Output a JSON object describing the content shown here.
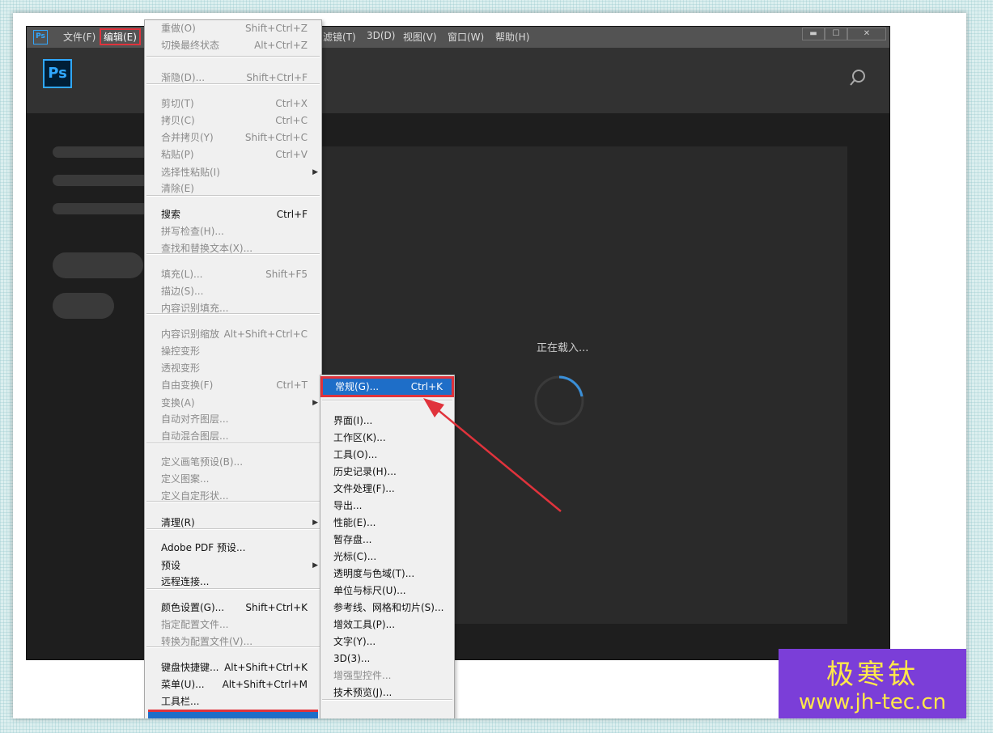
{
  "menubar": {
    "items": [
      "文件(F)",
      "编辑(E)",
      "滤镜(T)",
      "3D(D)",
      "视图(V)",
      "窗口(W)",
      "帮助(H)"
    ],
    "ps_badge": "Ps",
    "window_controls": [
      "▬",
      "☐",
      "✕"
    ]
  },
  "topbar": {
    "logo": "Ps"
  },
  "main": {
    "loading_text": "正在载入..."
  },
  "edit_menu": {
    "items": [
      {
        "label": "重做(O)",
        "shortcut": "Shift+Ctrl+Z"
      },
      {
        "label": "切换最终状态",
        "shortcut": "Alt+Ctrl+Z"
      },
      {
        "label": "渐隐(D)...",
        "shortcut": "Shift+Ctrl+F"
      },
      {
        "label": "剪切(T)",
        "shortcut": "Ctrl+X"
      },
      {
        "label": "拷贝(C)",
        "shortcut": "Ctrl+C"
      },
      {
        "label": "合并拷贝(Y)",
        "shortcut": "Shift+Ctrl+C"
      },
      {
        "label": "粘贴(P)",
        "shortcut": "Ctrl+V"
      },
      {
        "label": "选择性粘贴(I)",
        "shortcut": ""
      },
      {
        "label": "清除(E)",
        "shortcut": ""
      },
      {
        "label": "搜索",
        "shortcut": "Ctrl+F"
      },
      {
        "label": "拼写检查(H)...",
        "shortcut": ""
      },
      {
        "label": "查找和替换文本(X)...",
        "shortcut": ""
      },
      {
        "label": "填充(L)...",
        "shortcut": "Shift+F5"
      },
      {
        "label": "描边(S)...",
        "shortcut": ""
      },
      {
        "label": "内容识别填充...",
        "shortcut": ""
      },
      {
        "label": "内容识别缩放",
        "shortcut": "Alt+Shift+Ctrl+C"
      },
      {
        "label": "操控变形",
        "shortcut": ""
      },
      {
        "label": "透视变形",
        "shortcut": ""
      },
      {
        "label": "自由变换(F)",
        "shortcut": "Ctrl+T"
      },
      {
        "label": "变换(A)",
        "shortcut": ""
      },
      {
        "label": "自动对齐图层...",
        "shortcut": ""
      },
      {
        "label": "自动混合图层...",
        "shortcut": ""
      },
      {
        "label": "定义画笔预设(B)...",
        "shortcut": ""
      },
      {
        "label": "定义图案...",
        "shortcut": ""
      },
      {
        "label": "定义自定形状...",
        "shortcut": ""
      },
      {
        "label": "清理(R)",
        "shortcut": ""
      },
      {
        "label": "Adobe PDF 预设...",
        "shortcut": ""
      },
      {
        "label": "预设",
        "shortcut": ""
      },
      {
        "label": "远程连接...",
        "shortcut": ""
      },
      {
        "label": "颜色设置(G)...",
        "shortcut": "Shift+Ctrl+K"
      },
      {
        "label": "指定配置文件...",
        "shortcut": ""
      },
      {
        "label": "转换为配置文件(V)...",
        "shortcut": ""
      },
      {
        "label": "键盘快捷键...",
        "shortcut": "Alt+Shift+Ctrl+K"
      },
      {
        "label": "菜单(U)...",
        "shortcut": "Alt+Shift+Ctrl+M"
      },
      {
        "label": "工具栏...",
        "shortcut": ""
      }
    ]
  },
  "prefs_submenu": {
    "items": [
      {
        "label": "常规(G)...",
        "shortcut": "Ctrl+K"
      },
      {
        "label": "界面(I)..."
      },
      {
        "label": "工作区(K)..."
      },
      {
        "label": "工具(O)..."
      },
      {
        "label": "历史记录(H)..."
      },
      {
        "label": "文件处理(F)..."
      },
      {
        "label": "导出..."
      },
      {
        "label": "性能(E)..."
      },
      {
        "label": "暂存盘..."
      },
      {
        "label": "光标(C)..."
      },
      {
        "label": "透明度与色域(T)..."
      },
      {
        "label": "单位与标尺(U)..."
      },
      {
        "label": "参考线、网格和切片(S)..."
      },
      {
        "label": "增效工具(P)..."
      },
      {
        "label": "文字(Y)..."
      },
      {
        "label": "3D(3)..."
      },
      {
        "label": "增强型控件..."
      },
      {
        "label": "技术预览(J)..."
      }
    ]
  },
  "watermark": {
    "cn": "极寒钛",
    "url": "www.jh-tec.cn"
  },
  "colors": {
    "accent": "#31a8ff",
    "highlight": "#1e6ec8",
    "annotation": "#e0333c",
    "watermark_bg": "#7b3ed8"
  }
}
